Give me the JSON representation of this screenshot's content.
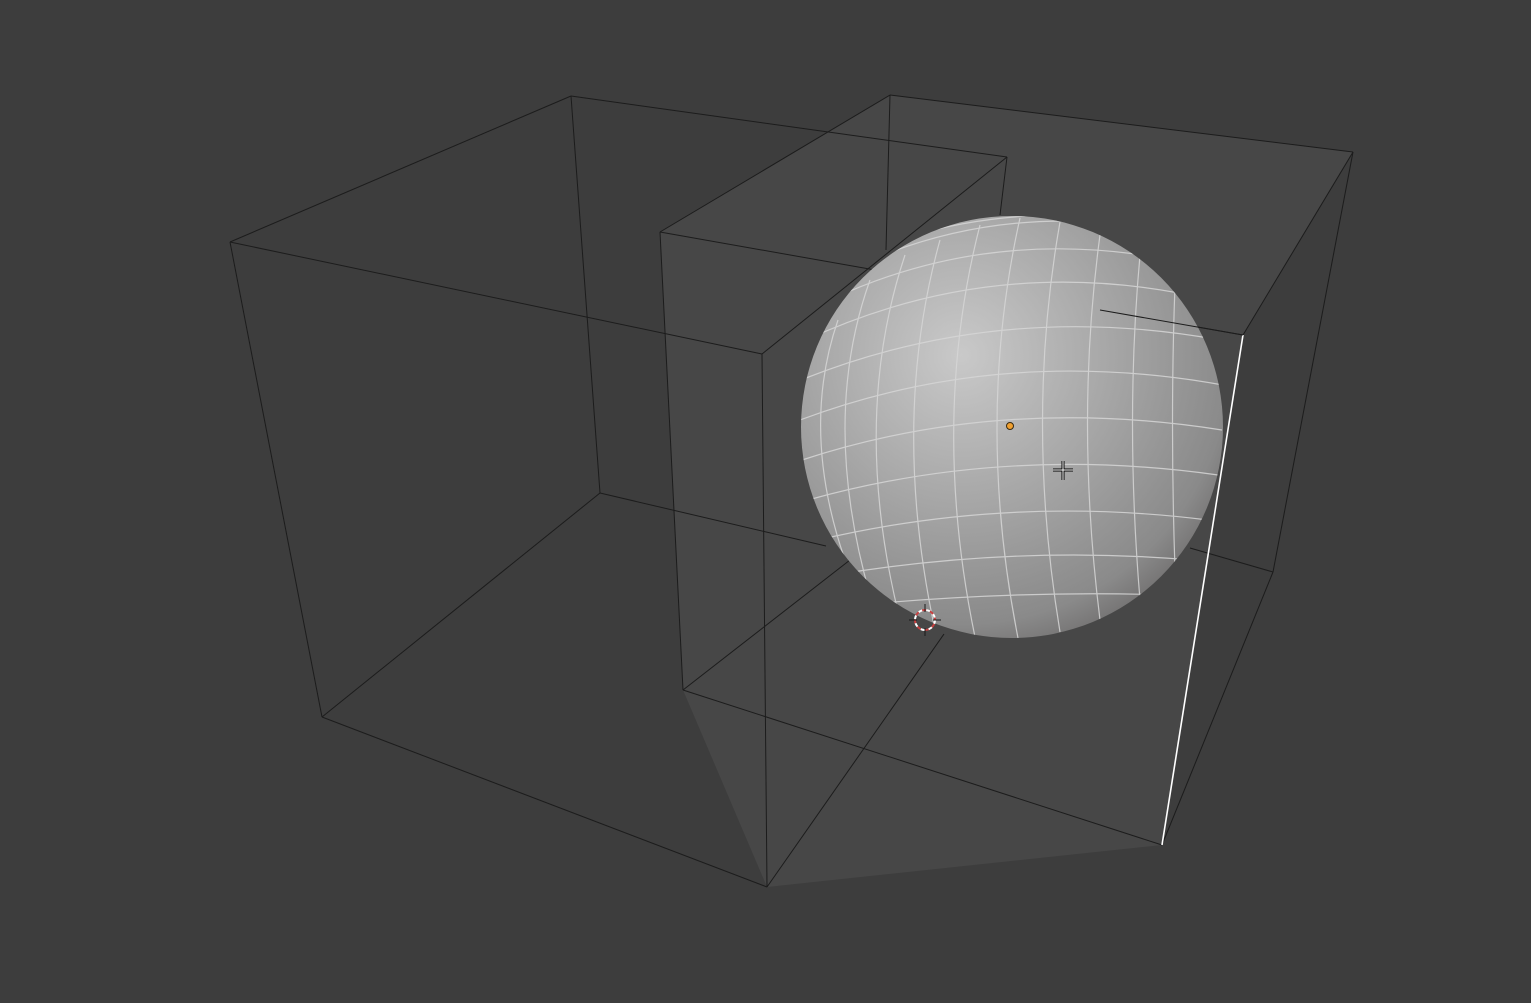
{
  "viewport": {
    "mode": "3d-viewport",
    "background_color": "#3d3d3d",
    "objects": [
      {
        "name": "bounding-box-left",
        "type": "wireframe-box",
        "color": "#1a1a1a"
      },
      {
        "name": "bounding-box-right",
        "type": "wireframe-box",
        "color": "#1a1a1a",
        "fill": "#464646"
      },
      {
        "name": "uv-sphere",
        "type": "mesh",
        "shading": "solid",
        "color": "#a9a9a9",
        "wire_color": "#d8d8d8"
      }
    ],
    "selected_edge_color": "#ffffff",
    "origin_point_color": "#f0a030",
    "cursor_3d": {
      "ring_colors": [
        "#c84040",
        "#ffffff"
      ]
    },
    "mouse_cursor": "crosshair"
  }
}
